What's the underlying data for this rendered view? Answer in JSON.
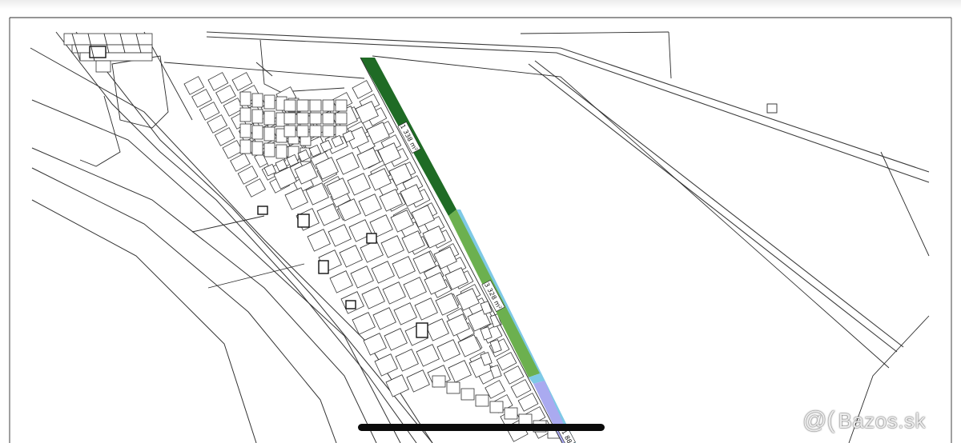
{
  "map": {
    "plots": [
      {
        "id": "plot-1",
        "area_label": "1 338 m²",
        "color": "#1f6b25"
      },
      {
        "id": "plot-2",
        "area_label": "3 328 m²",
        "color": "#6cb04f"
      },
      {
        "id": "plot-3",
        "area_label": "",
        "color": "#aaaaf0"
      },
      {
        "id": "edge-strip",
        "area_label": "",
        "color": "#7ec9e6"
      }
    ],
    "third_plot_partial_label": "1 88"
  },
  "watermark": {
    "logo_icon": "at-icon",
    "logo_glyph": "@(",
    "text": "Bazos.sk"
  },
  "home_indicator": {
    "color": "#0b0b0b"
  }
}
